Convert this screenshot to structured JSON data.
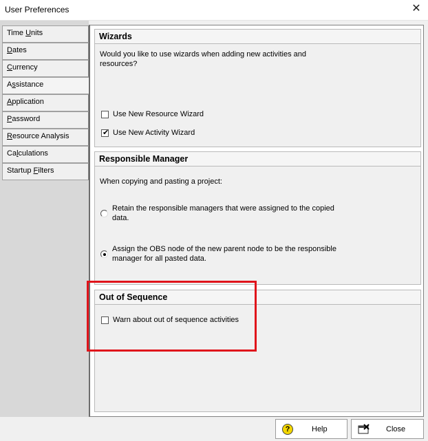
{
  "window": {
    "title": "User Preferences",
    "close_glyph": "✕"
  },
  "tabs": [
    {
      "label": "Time Units"
    },
    {
      "label": "Dates"
    },
    {
      "label": "Currency"
    },
    {
      "label": "Assistance"
    },
    {
      "label": "Application"
    },
    {
      "label": "Password"
    },
    {
      "label": "Resource Analysis"
    },
    {
      "label": "Calculations"
    },
    {
      "label": "Startup Filters"
    }
  ],
  "active_tab": "Assistance",
  "wizards": {
    "header": "Wizards",
    "prompt_line1": "Would you like to use wizards when adding new activities and",
    "prompt_line2": "resources?",
    "resource_wizard_label": "Use New Resource Wizard",
    "resource_wizard_checked": false,
    "activity_wizard_label": "Use New Activity Wizard",
    "activity_wizard_checked": true
  },
  "responsible_manager": {
    "header": "Responsible Manager",
    "intro": "When copying and pasting a project:",
    "option1_line1": "Retain the responsible managers that were assigned to the copied",
    "option1_line2": "data.",
    "option2_line1": "Assign the OBS node of the new parent node to be the responsible",
    "option2_line2": "manager for all pasted data.",
    "selected_option": 2
  },
  "out_of_sequence": {
    "header": "Out of Sequence",
    "warn_label": "Warn about out of sequence activities",
    "warn_checked": false
  },
  "buttons": {
    "help_label": "Help",
    "close_label": "Close"
  },
  "icons": {
    "help": "help-icon",
    "close": "close-dialog-icon"
  },
  "colors": {
    "highlight": "#e0141b"
  }
}
